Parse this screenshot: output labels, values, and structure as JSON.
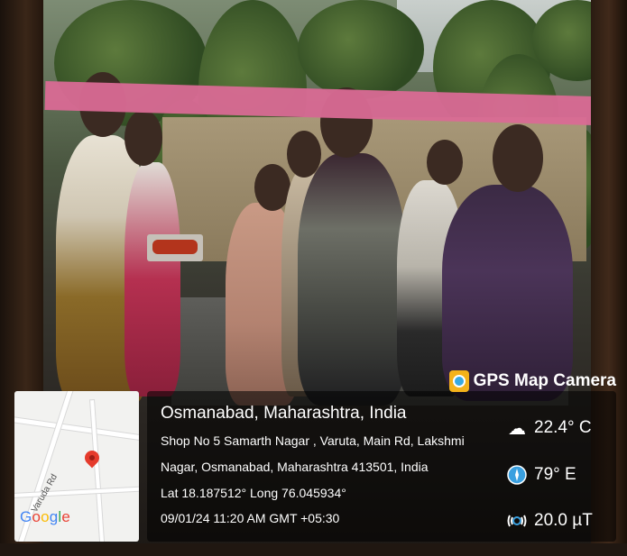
{
  "overlay": {
    "brand": "GPS Map Camera",
    "location_title": "Osmanabad, Maharashtra, India",
    "address_line1": "Shop No 5 Samarth Nagar , Varuta, Main Rd, Lakshmi",
    "address_line2": "Nagar, Osmanabad, Maharashtra 413501, India",
    "coordinates": "Lat 18.187512° Long 76.045934°",
    "datetime": "09/01/24 11:20 AM GMT +05:30",
    "temperature": "22.4° C",
    "direction": "79° E",
    "magnetic_field": "20.0 µT"
  },
  "map": {
    "road_label": "Varuda Rd",
    "google_logo": "Google",
    "pin_color": "#e53b2c"
  },
  "icons": {
    "brand_icon": "gps-map-camera-icon",
    "weather_icon": "partly-cloudy-icon",
    "compass_icon": "compass-icon",
    "magnet_icon": "magnetic-field-icon"
  }
}
